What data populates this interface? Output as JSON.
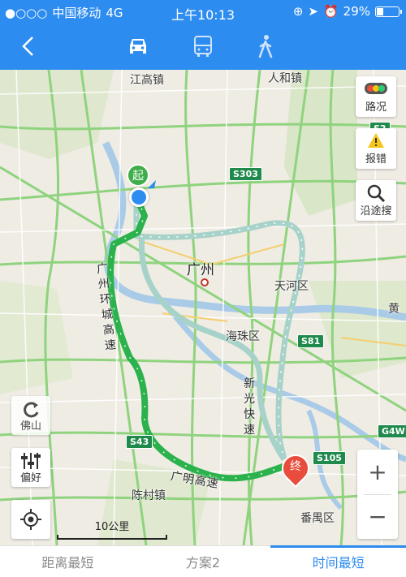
{
  "status": {
    "dots": "●○○○",
    "carrier": "中国移动",
    "network": "4G",
    "time": "上午10:13",
    "battery_pct": "29%",
    "battery_fraction": 0.29
  },
  "nav": {
    "back_icon": "chevron-left-icon",
    "modes": [
      "car-icon",
      "bus-icon",
      "walk-icon"
    ],
    "active_mode": 0,
    "accent": "#2d8cf0"
  },
  "map": {
    "places": {
      "jianggao": "江高镇",
      "renhe": "人和镇",
      "guangzhou": "广州",
      "tianhe": "天河区",
      "haizhu": "海珠区",
      "huang": "黄",
      "chencun": "陈村镇",
      "panyu": "番禺区",
      "foshan": "佛山"
    },
    "shields": {
      "s2": "S2",
      "s303": "S303",
      "s81": "S81",
      "s43": "S43",
      "s105": "S105",
      "g4w": "G4W"
    },
    "roads": {
      "huancheng": "广州环城高速",
      "guangming": "广明高速",
      "xinguang": "新光快速"
    },
    "start_label": "起",
    "end_label": "终",
    "scale_label": "10公里"
  },
  "side": {
    "traffic": "路况",
    "report": "报错",
    "along": "沿途搜"
  },
  "left": {
    "prefer": "偏好",
    "foshan_btn": "佛山"
  },
  "zoom": {
    "in": "+",
    "out": "−"
  },
  "tabs": [
    {
      "label": "距离最短",
      "active": false
    },
    {
      "label": "方案2",
      "active": false
    },
    {
      "label": "时间最短",
      "active": true
    }
  ]
}
